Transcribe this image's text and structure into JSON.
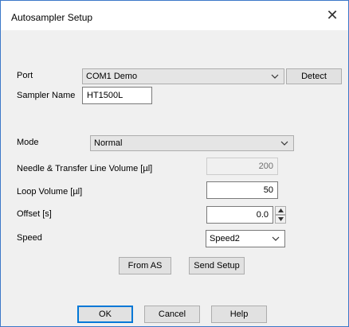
{
  "window": {
    "title": "Autosampler Setup"
  },
  "port": {
    "label": "Port",
    "value": "COM1 Demo",
    "detect_label": "Detect"
  },
  "sampler_name": {
    "label": "Sampler Name",
    "value": "HT1500L"
  },
  "mode": {
    "label": "Mode",
    "value": "Normal"
  },
  "needle_volume": {
    "label": "Needle & Transfer Line Volume [µl]",
    "value": "200"
  },
  "loop_volume": {
    "label": "Loop Volume [µl]",
    "value": "50"
  },
  "offset": {
    "label": "Offset [s]",
    "value": "0.0"
  },
  "speed": {
    "label": "Speed",
    "value": "Speed2"
  },
  "buttons": {
    "from_as": "From AS",
    "send_setup": "Send Setup",
    "ok": "OK",
    "cancel": "Cancel",
    "help": "Help"
  },
  "icons": {
    "close": "close-icon",
    "dropdown": "chevron-down-icon",
    "spin_up": "spin-up-icon",
    "spin_down": "spin-down-icon"
  },
  "colors": {
    "window_border": "#3c78c8",
    "dialog_bg": "#f0f0f0",
    "default_button_border": "#0078d7"
  }
}
